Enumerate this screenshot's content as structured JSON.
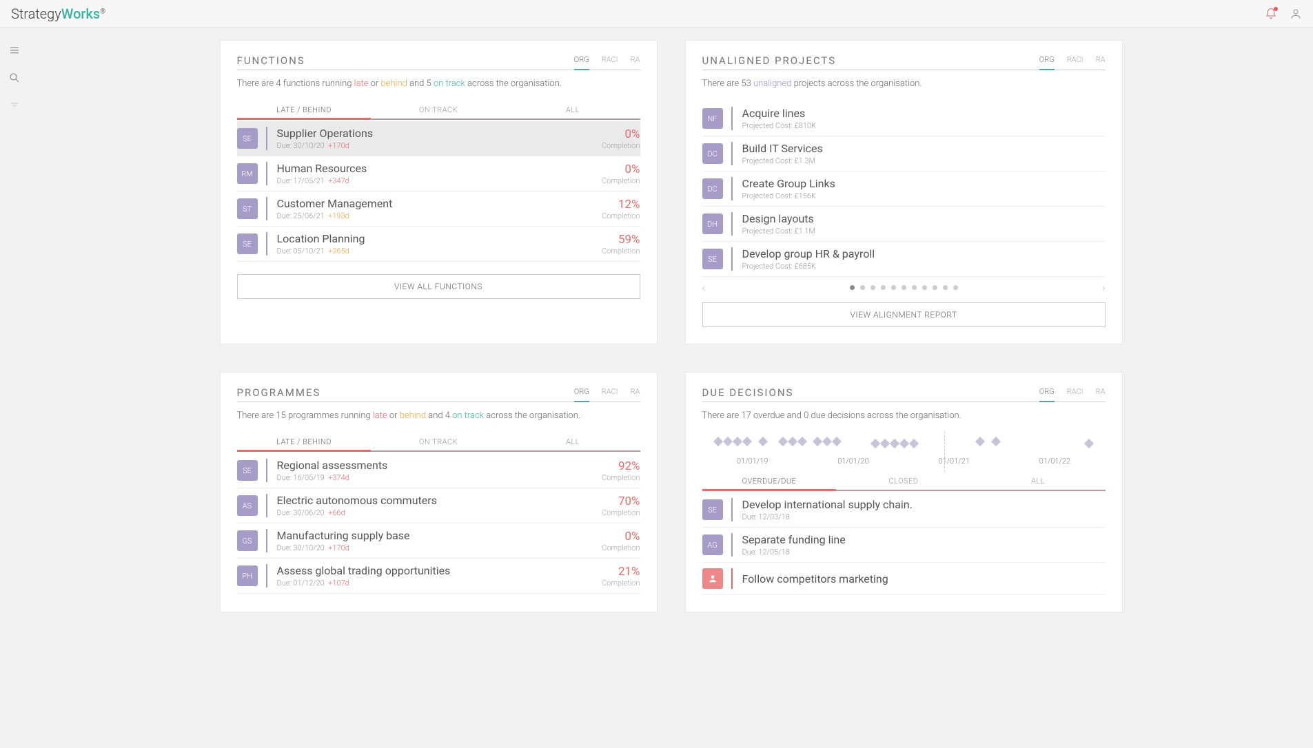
{
  "brand": {
    "part1": "Strategy",
    "part2": "Works",
    "reg": "®"
  },
  "scope_tabs": [
    "ORG",
    "RACI",
    "RA"
  ],
  "functions": {
    "title": "FUNCTIONS",
    "summary_pre": "There are ",
    "count_late": "4",
    "summary_mid1": " functions running ",
    "late": "late",
    "or": " or ",
    "behind": "behind",
    "summary_mid2": " and ",
    "count_on": "5",
    "ontrack": "on track",
    "summary_post": " across the organisation.",
    "filter_tabs": [
      "LATE / BEHIND",
      "ON TRACK",
      "ALL"
    ],
    "rows": [
      {
        "av": "SE",
        "title": "Supplier Operations",
        "due": "Due: 30/10/20",
        "delta": "+170d",
        "dclass": "late",
        "pct": "0%",
        "sel": true
      },
      {
        "av": "RM",
        "title": "Human Resources",
        "due": "Due: 17/05/21",
        "delta": "+347d",
        "dclass": "late",
        "pct": "0%"
      },
      {
        "av": "ST",
        "title": "Customer Management",
        "due": "Due: 25/06/21",
        "delta": "+193d",
        "dclass": "behind",
        "pct": "12%"
      },
      {
        "av": "SE",
        "title": "Location Planning",
        "due": "Due: 05/10/21",
        "delta": "+265d",
        "dclass": "behind",
        "pct": "59%"
      }
    ],
    "view_all": "VIEW ALL FUNCTIONS",
    "completion_label": "Completion"
  },
  "unaligned": {
    "title": "UNALIGNED PROJECTS",
    "summary_pre": "There are ",
    "count": "53",
    "unaligned_word": "unaligned",
    "summary_post": " projects across the organisation.",
    "rows": [
      {
        "av": "NF",
        "title": "Acquire lines",
        "sub": "Projected Cost: £810K"
      },
      {
        "av": "DC",
        "title": "Build IT Services",
        "sub": "Projected Cost: £1.3M"
      },
      {
        "av": "DC",
        "title": "Create Group Links",
        "sub": "Projected Cost: £156K"
      },
      {
        "av": "DH",
        "title": "Design layouts",
        "sub": "Projected Cost: £1.1M"
      },
      {
        "av": "SE",
        "title": "Develop group HR & payroll",
        "sub": "Projected Cost: £685K"
      }
    ],
    "view_all": "VIEW ALIGNMENT REPORT",
    "pager_dots": 11
  },
  "programmes": {
    "title": "PROGRAMMES",
    "summary_pre": "There are ",
    "count_late": "15",
    "summary_mid1": " programmes running ",
    "late": "late",
    "or": " or ",
    "behind": "behind",
    "summary_mid2": " and ",
    "count_on": "4",
    "ontrack": "on track",
    "summary_post": " across the organisation.",
    "filter_tabs": [
      "LATE / BEHIND",
      "ON TRACK",
      "ALL"
    ],
    "rows": [
      {
        "av": "SE",
        "title": "Regional assessments",
        "due": "Due: 16/05/19",
        "delta": "+374d",
        "dclass": "late",
        "pct": "92%"
      },
      {
        "av": "AS",
        "title": "Electric autonomous commuters",
        "due": "Due: 30/06/20",
        "delta": "+66d",
        "dclass": "late",
        "pct": "70%"
      },
      {
        "av": "GS",
        "title": "Manufacturing supply base",
        "due": "Due: 30/10/20",
        "delta": "+170d",
        "dclass": "late",
        "pct": "0%"
      },
      {
        "av": "PH",
        "title": "Assess global trading opportunities",
        "due": "Due: 01/12/20",
        "delta": "+107d",
        "dclass": "late",
        "pct": "21%"
      }
    ],
    "completion_label": "Completion"
  },
  "decisions": {
    "title": "DUE DECISIONS",
    "summary": "There are 17 overdue and 0 due decisions across the organisation.",
    "timeline_labels": [
      "01/01/19",
      "01/01/20",
      "01/01/21",
      "01/01/22"
    ],
    "filter_tabs": [
      "OVERDUE/DUE",
      "CLOSED",
      "ALL"
    ],
    "rows": [
      {
        "av": "SE",
        "avclass": "",
        "title": "Develop international supply chain.",
        "sub": "Due: 12/03/18"
      },
      {
        "av": "AG",
        "avclass": "",
        "title": "Separate funding line",
        "sub": "Due: 12/05/18"
      },
      {
        "av": "",
        "avclass": "red",
        "title": "Follow competitors marketing",
        "sub": ""
      }
    ]
  }
}
